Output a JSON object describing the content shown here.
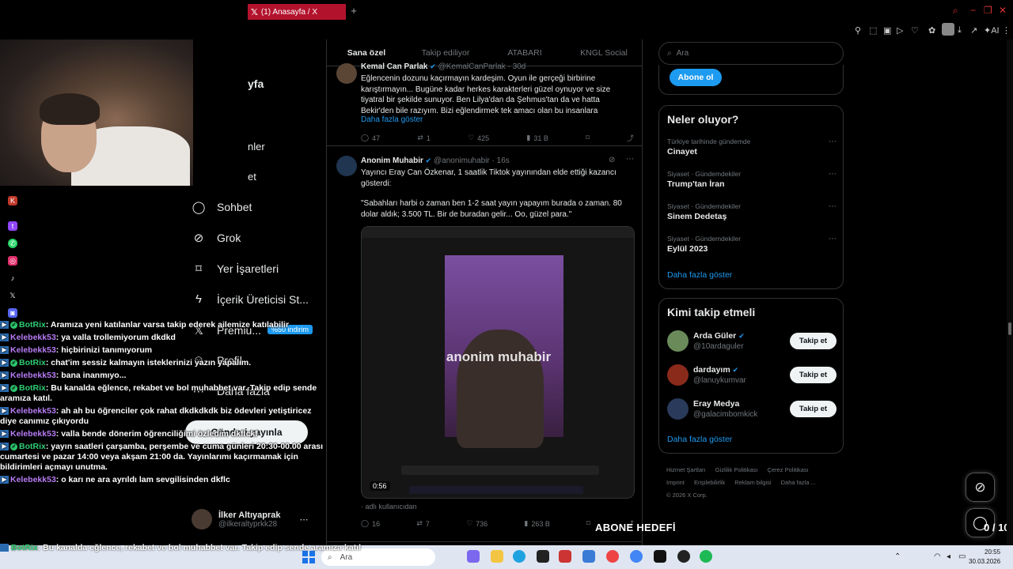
{
  "browser": {
    "tab_title": "(1) Anasayfa / X",
    "tab_icon": "X"
  },
  "nav": {
    "partial_title": "yfa",
    "partial_1": "nler",
    "partial_2": "et",
    "items": [
      {
        "label": "Sohbet",
        "icon": "chat-icon"
      },
      {
        "label": "Grok",
        "icon": "grok-icon"
      },
      {
        "label": "Yer İşaretleri",
        "icon": "bookmark-icon"
      },
      {
        "label": "İçerik Üreticisi St...",
        "icon": "lightning-icon"
      },
      {
        "label": "Premiu...",
        "icon": "x-icon"
      },
      {
        "label": "Profil",
        "icon": "person-icon"
      },
      {
        "label": "Daha fazla",
        "icon": "more-icon"
      }
    ],
    "premium_badge": "%50 indirim",
    "post_button": "Gönderi yayınla",
    "account_name": "İlker Altıyaprak",
    "account_handle": "@ilkeraltyprkk28"
  },
  "chat": [
    {
      "user": "BotRix",
      "type": "bot",
      "text": ": Aramıza yeni katılanlar varsa takip ederek ailemize katılabilir"
    },
    {
      "user": "Kelebekk53",
      "type": "user",
      "text": ": ya valla trollemiyorum dkdkd"
    },
    {
      "user": "Kelebekk53",
      "type": "user",
      "text": ": hiçbirinizi tanımıyorum"
    },
    {
      "user": "BotRix",
      "type": "bot",
      "text": ": chat'im sessiz kalmayın isteklerinizi yazın yapalım."
    },
    {
      "user": "Kelebekk53",
      "type": "user",
      "text": ": bana inanmıyo..."
    },
    {
      "user": "BotRix",
      "type": "bot",
      "text": ": Bu kanalda eğlence, rekabet ve bol muhabbet var. Takip edip sende aramıza katıl."
    },
    {
      "user": "Kelebekk53",
      "type": "user",
      "text": ": ah ah bu öğrenciler çok rahat dkdkdkdk biz ödevleri yetiştiricez diye canımız çıkıyordu"
    },
    {
      "user": "Kelebekk53",
      "type": "user",
      "text": ": valla bende dönerim öğrenciliğimi özledim dkflckf"
    },
    {
      "user": "BotRix",
      "type": "bot",
      "text": ": yayın saatleri çarşamba, perşembe ve cuma günleri 20:30-00.00 arası cumartesi ve pazar 14:00 veya akşam 21:00 da. Yayınlarımı kaçırmamak için bildirimleri açmayı unutma."
    },
    {
      "user": "Kelebekk53",
      "type": "user",
      "text": ": o karı ne ara ayrıldı lam sevgilisinden dkflc"
    }
  ],
  "chat_bottom": {
    "user": "BotRix",
    "text": ": Bu kanalda eğlence, rekabet ve bol muhabbet var. Takip edip sende aramıza katıl"
  },
  "timeline": {
    "tabs": [
      "Sana özel",
      "Takip ediliyor",
      "ATABARI",
      "KNGL Social"
    ],
    "tweet1": {
      "name": "Kemal Can Parlak",
      "handle": "@KemalCanParlak · 30d",
      "text": "Eğlencenin dozunu kaçırmayın kardeşim. Oyun ile gerçeği birbirine karıştırmayın... Bugüne kadar herkes karakterleri güzel oynuyor ve size tiyatral bir şekilde sunuyor. Ben Lilya'dan da Şehmus'tan da ve hatta Bekir'den bile razıyım. Bizi eğlendirmek tek amacı olan bu insanlara",
      "show_more": "Daha fazla göster",
      "replies": "47",
      "reposts": "1",
      "likes": "425",
      "views": "31 B"
    },
    "tweet2": {
      "name": "Anonim Muhabir",
      "handle": "@anonimuhabir · 16s",
      "text1": "Yayıncı Eray Can Özkenar, 1 saatlik Tiktok yayınından elde ettiği kazancı gösterdi:",
      "text2": "\"Sabahları harbi o zaman ben 1-2 saat yayın yapayım burada o zaman. 80 dolar aldık; 3.500 TL. Bir de buradan gelir... Oo, güzel para.\"",
      "video_watermark": "anonim muhabir",
      "duration": "0:56",
      "attribution": "adlı kullanıcıdan",
      "replies": "16",
      "reposts": "7",
      "likes": "736",
      "views": "263 B"
    }
  },
  "right": {
    "search_placeholder": "Ara",
    "subscribe_button": "Abone ol",
    "trends_title": "Neler oluyor?",
    "trends": [
      {
        "context": "Türkiye tarihinde gündemde",
        "title": "Cinayet"
      },
      {
        "context": "Siyaset · Gündemdekiler",
        "title": "Trump'tan İran"
      },
      {
        "context": "Siyaset · Gündemdekiler",
        "title": "Sinem Dedetaş"
      },
      {
        "context": "Siyaset · Gündemdekiler",
        "title": "Eylül 2023"
      }
    ],
    "trends_more": "Daha fazla göster",
    "who_title": "Kimi takip etmeli",
    "who": [
      {
        "name": "Arda Güler",
        "handle": "@10ardaguler",
        "button": "Takip et"
      },
      {
        "name": "dardayım",
        "handle": "@lanuykumvar",
        "button": "Takip et"
      },
      {
        "name": "Eray Medya",
        "handle": "@galacimbomkick",
        "button": "Takip et"
      }
    ],
    "who_more": "Daha fazla göster",
    "footer": [
      "Hizmet Şartları",
      "Gizlilik Politikası",
      "Çerez Politikası",
      "Imprint",
      "Erişilebilirlik",
      "Reklam bilgisi",
      "Daha fazla ...",
      "© 2026 X Corp."
    ]
  },
  "overlay": {
    "goal_label": "ABONE HEDEFİ",
    "goal_count": "0 / 10"
  },
  "taskbar": {
    "search": "Ara",
    "time": "20:55",
    "date": "30.03.2026"
  },
  "colors": {
    "x_blue": "#1d9bf0",
    "tab_red": "#b3122d",
    "bot_green": "#2ecc71",
    "chat_purple": "#b77cf5"
  }
}
